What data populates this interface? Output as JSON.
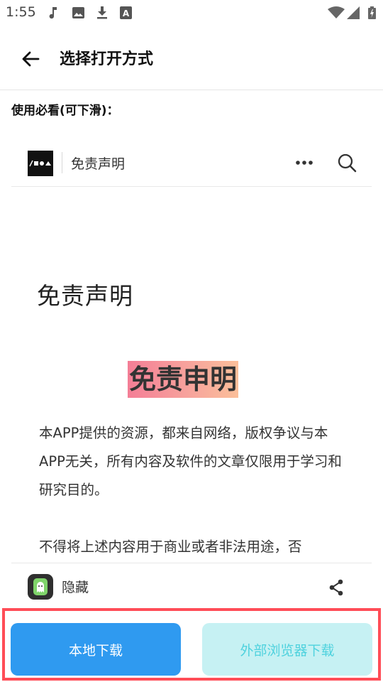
{
  "status_bar": {
    "time": "1:55",
    "icons": [
      "music-note-icon",
      "image-icon",
      "download-icon",
      "a-icon",
      "wifi-icon",
      "signal-icon",
      "battery-icon"
    ]
  },
  "app_bar": {
    "back_icon": "arrow-left-icon",
    "title": "选择打开方式"
  },
  "usage_label": "使用必看(可下滑)：",
  "web_page": {
    "logo_text": "/■●▲",
    "site_name": "免责声明",
    "more_icon": "more-horizontal-icon",
    "search_icon": "search-icon",
    "article_title": "免责声明",
    "highlight_title": "免责申明",
    "paragraph1": "本APP提供的资源，都来自网络，版权争议与本APP无关，所有内容及软件的文章仅限用于学习和研究目的。",
    "paragraph2": "不得将上述内容用于商业或者非法用途，否"
  },
  "file_row": {
    "app_icon": "ghost-icon",
    "name": "隐藏",
    "share_icon": "share-icon"
  },
  "buttons": {
    "local_download": "本地下载",
    "browser_download": "外部浏览器下载"
  },
  "colors": {
    "primary_button": "#2f9af0",
    "secondary_button": "#c6f1f3",
    "highlight_border": "#ff4d57"
  }
}
